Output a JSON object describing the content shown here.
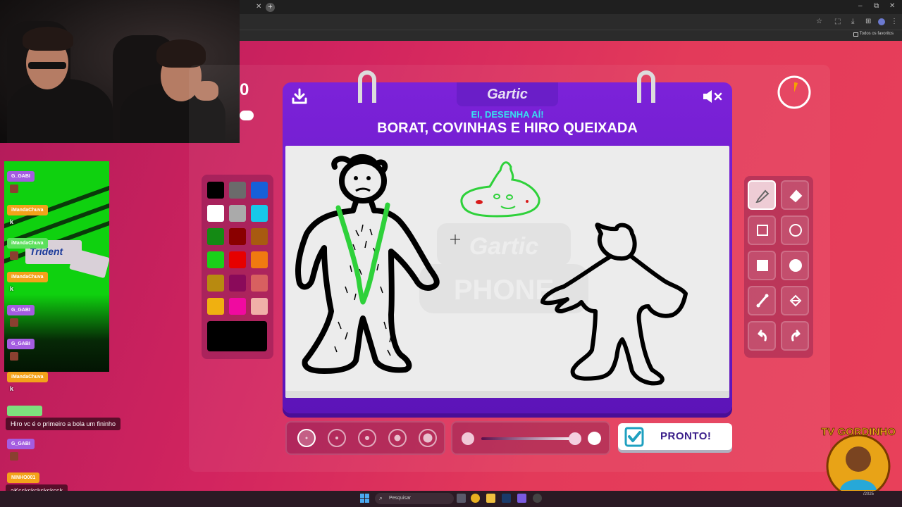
{
  "browser": {
    "bookmarks_label": "Todos os favoritos",
    "new_tab_glyph": "+",
    "win_min": "–",
    "win_max": "⧉",
    "win_close": "✕"
  },
  "stream": {
    "side_score": "0",
    "chat": [
      {
        "user": "G_GABI",
        "tag_color": "#a45ce0",
        "message": ""
      },
      {
        "user": "iMandaChuva",
        "tag_color": "#f3a21a",
        "message": "k"
      },
      {
        "user": "iMandaChuva",
        "tag_color": "#5ce05c",
        "message": ""
      },
      {
        "user": "iMandaChuva",
        "tag_color": "#f3a21a",
        "message": "k"
      },
      {
        "user": "G_GABI",
        "tag_color": "#a45ce0",
        "message": ""
      },
      {
        "user": "G_GABI",
        "tag_color": "#a45ce0",
        "message": ""
      },
      {
        "user": "iMandaChuva",
        "tag_color": "#f3a21a",
        "message": "k"
      },
      {
        "user": "",
        "tag_color": "#7de07d",
        "message": "Hiro vc é o primeiro a bola um fininho"
      },
      {
        "user": "G_GABI",
        "tag_color": "#a45ce0",
        "message": ""
      },
      {
        "user": "NINHO001",
        "tag_color": "#f3a21a",
        "message": "aKsskskskskskssk"
      }
    ],
    "video_brand": "Trident",
    "channel_logo_text": "TV GORDINHO"
  },
  "game": {
    "logo": "Gartic",
    "hint": "EI, DESENHA AÍ!",
    "prompt": "BORAT, COVINHAS E HIRO QUEIXADA",
    "done_label": "PRONTO!",
    "watermark": "Gartic PHONE",
    "timer_fraction_elapsed": 0.06,
    "palette": [
      "#000000",
      "#6b6b6b",
      "#1660d8",
      "#ffffff",
      "#aaaaaa",
      "#17c8e8",
      "#148a14",
      "#8a0000",
      "#a85a10",
      "#19d119",
      "#e60000",
      "#f07a10",
      "#b88a10",
      "#8a0a5a",
      "#d86060",
      "#f0b010",
      "#f00aa0",
      "#f0b0a8"
    ],
    "current_color": "#000000",
    "brush_sizes": 5,
    "selected_brush_size_index": 0,
    "opacity_value": 0.95,
    "tools": [
      "pencil-icon",
      "eraser-icon",
      "rectangle-outline-icon",
      "circle-outline-icon",
      "rectangle-fill-icon",
      "circle-fill-icon",
      "line-icon",
      "bucket-icon",
      "undo-icon",
      "redo-icon"
    ],
    "active_tool": "pencil-icon"
  },
  "taskbar": {
    "search_label": "Pesquisar",
    "date_fragment": "/2025"
  }
}
